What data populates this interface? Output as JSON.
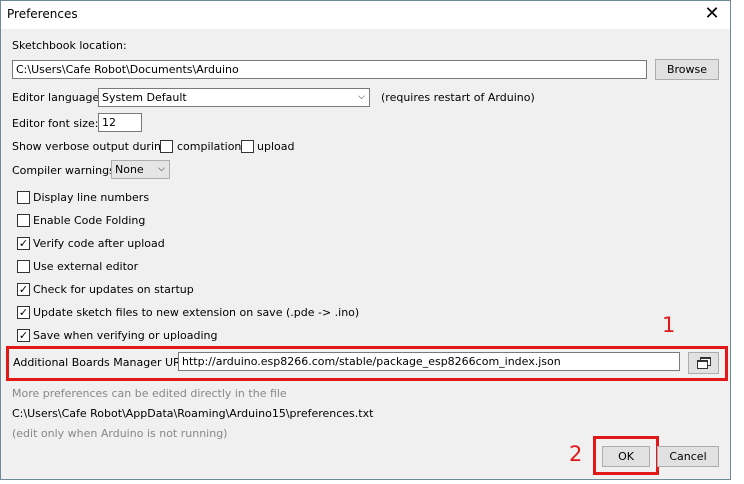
{
  "window": {
    "title": "Preferences",
    "close_glyph": "✕"
  },
  "sketchbook": {
    "label": "Sketchbook location:",
    "path": "C:\\Users\\Cafe Robot\\Documents\\Arduino",
    "browse_label": "Browse"
  },
  "editor_language": {
    "label": "Editor language:",
    "value": "System Default",
    "note": "(requires restart of Arduino)"
  },
  "font_size": {
    "label": "Editor font size:",
    "value": "12"
  },
  "verbose": {
    "label": "Show verbose output during:",
    "compilation_label": "compilation",
    "upload_label": "upload"
  },
  "compiler_warnings": {
    "label": "Compiler warnings:",
    "value": "None"
  },
  "options": [
    {
      "label": "Display line numbers",
      "checked": false
    },
    {
      "label": "Enable Code Folding",
      "checked": false
    },
    {
      "label": "Verify code after upload",
      "checked": true
    },
    {
      "label": "Use external editor",
      "checked": false
    },
    {
      "label": "Check for updates on startup",
      "checked": true
    },
    {
      "label": "Update sketch files to new extension on save (.pde -> .ino)",
      "checked": true
    },
    {
      "label": "Save when verifying or uploading",
      "checked": true
    }
  ],
  "boards_manager": {
    "label": "Additional Boards Manager URLs:",
    "url": "http://arduino.esp8266.com/stable/package_esp8266com_index.json",
    "button_icon": "window-stack-icon"
  },
  "footer": {
    "more_prefs": "More preferences can be edited directly in the file",
    "prefs_path": "C:\\Users\\Cafe Robot\\AppData\\Roaming\\Arduino15\\preferences.txt",
    "edit_note": "(edit only when Arduino is not running)"
  },
  "buttons": {
    "ok_label": "OK",
    "cancel_label": "Cancel"
  },
  "annotations": {
    "step1": "1",
    "step2": "2",
    "color": "#e21717"
  }
}
